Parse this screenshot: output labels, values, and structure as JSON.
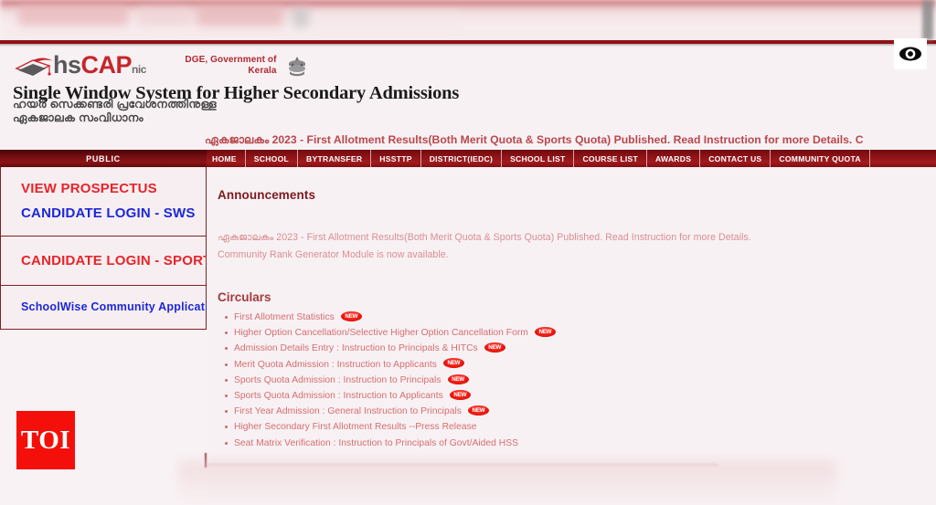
{
  "browser": {
    "eye_icon": "eye-icon",
    "scrollbar": "vertical-scrollbar-thumb"
  },
  "header": {
    "logo": {
      "icon": "graduation-cap-icon",
      "hs": "hs",
      "cap": "CAP",
      "nic": "nic"
    },
    "dge": {
      "line1": "DGE, Government of",
      "line2": "Kerala",
      "emblem": "kerala-state-emblem-icon"
    },
    "tagline_english": "Single Window System for Higher Secondary Admissions",
    "tagline_malayalam_line1": "ഹയർ സെക്കണ്ടരി പ്രവേശനത്തിനുള്ള",
    "tagline_malayalam_line2": "ഏകജാലക സംവിധാനം"
  },
  "marquee": {
    "text": "ഏകജാലകം 2023 - First Allotment Results(Both Merit Quota & Sports Quota) Published. Read Instruction for more Details. C"
  },
  "nav": {
    "items": [
      {
        "label": "HOME"
      },
      {
        "label": "SCHOOL"
      },
      {
        "label": "BYTRANSFER"
      },
      {
        "label": "HSSTTP"
      },
      {
        "label": "DISTRICT(IEDC)"
      },
      {
        "label": "SCHOOL LIST"
      },
      {
        "label": "COURSE LIST"
      },
      {
        "label": "AWARDS"
      },
      {
        "label": "CONTACT US"
      },
      {
        "label": "COMMUNITY QUOTA"
      }
    ]
  },
  "sidebar": {
    "header": "PUBLIC",
    "group1": [
      {
        "label": "VIEW PROSPECTUS",
        "color": "#e8242b"
      },
      {
        "label": "CANDIDATE LOGIN - SWS",
        "color": "#1d28d8"
      }
    ],
    "group2": [
      {
        "label": "CANDIDATE LOGIN - SPORTS",
        "color": "#e8242b"
      }
    ],
    "group3": [
      {
        "label": "SchoolWise Community Applications",
        "color": "#1d28d8"
      }
    ]
  },
  "main": {
    "announcements_title": "Announcements",
    "announcements": [
      "ഏകജാലകം 2023 - First Allotment Results(Both Merit Quota & Sports Quota) Published. Read Instruction for more Details.",
      "Community Rank Generator Module is now available."
    ],
    "circulars_title": "Circulars",
    "circulars": [
      {
        "label": "First Allotment Statistics",
        "is_new": true
      },
      {
        "label": "Higher Option Cancellation/Selective Higher Option Cancellation Form",
        "is_new": true
      },
      {
        "label": "Admission Details Entry : Instruction to Principals & HITCs",
        "is_new": true
      },
      {
        "label": "Merit Quota Admission : Instruction to Applicants",
        "is_new": true
      },
      {
        "label": "Sports Quota Admission : Instruction to Principals",
        "is_new": true
      },
      {
        "label": "Sports Quota Admission : Instruction to Applicants",
        "is_new": true
      },
      {
        "label": "First Year Admission : General Instruction to Principals",
        "is_new": true
      },
      {
        "label": "Higher Secondary First Allotment Results --Press Release",
        "is_new": false
      },
      {
        "label": "Seat Matrix Verification : Instruction to Principals of Govt/Aided HSS",
        "is_new": false
      }
    ],
    "new_badge_label": "NEW"
  },
  "watermark": {
    "toi_label": "TOI"
  },
  "colors": {
    "nav_bar": "#8e1317",
    "accent_red": "#c4262c",
    "link_blue": "#1d28d8",
    "link_red": "#e8242b",
    "page_bg": "#f8f1f3",
    "toi_red": "#f40f0a"
  }
}
